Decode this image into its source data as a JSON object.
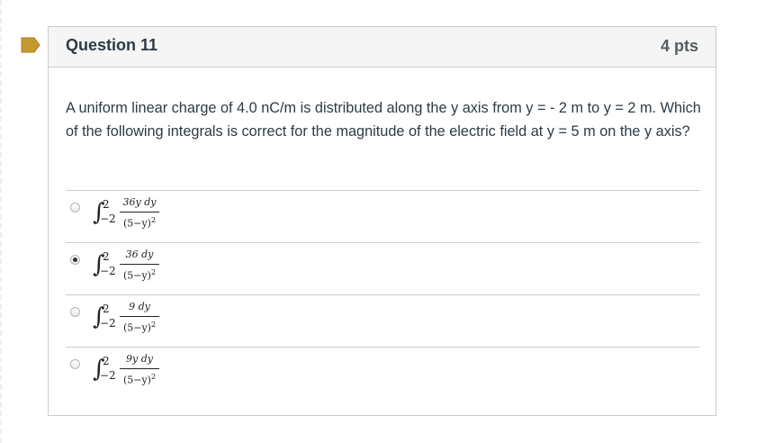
{
  "question": {
    "title": "Question 11",
    "points": "4 pts",
    "text": "A uniform linear charge of 4.0 nC/m is distributed along the y axis from y = - 2 m to y = 2 m. Which of the following integrals is correct for the magnitude of the electric field at y = 5 m on the y axis?"
  },
  "answers": [
    {
      "upper": "2",
      "lower": "−2",
      "numerator": "36y dy",
      "denominator": "(5−y)",
      "power": "2",
      "selected": false
    },
    {
      "upper": "2",
      "lower": "−2",
      "numerator": "36 dy",
      "denominator": "(5−y)",
      "power": "2",
      "selected": true
    },
    {
      "upper": "2",
      "lower": "−2",
      "numerator": "9 dy",
      "denominator": "(5−y)",
      "power": "2",
      "selected": false
    },
    {
      "upper": "2",
      "lower": "−2",
      "numerator": "9y dy",
      "denominator": "(5−y)",
      "power": "2",
      "selected": false
    }
  ],
  "colors": {
    "flag": "#c49a2f",
    "border": "#c7cdd1",
    "header_bg": "#f5f5f5",
    "text": "#2d3b45"
  },
  "icons": {
    "flag": "flag-icon"
  }
}
